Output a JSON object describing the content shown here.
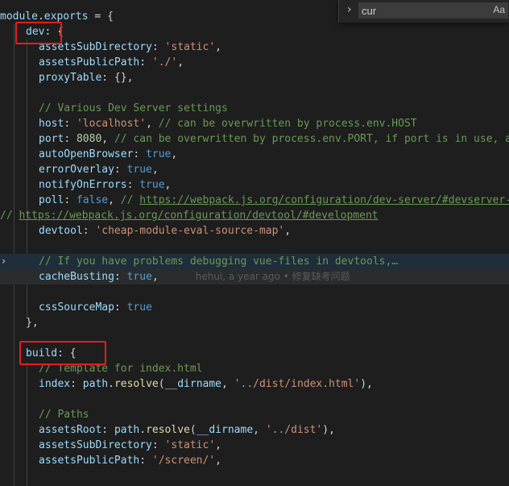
{
  "search": {
    "value": "cur",
    "match_case_label": "Aa"
  },
  "code": {
    "l0": {
      "a": "module",
      "b": ".",
      "c": "exports",
      "d": " = {"
    },
    "l1": {
      "a": "dev",
      "b": ": {"
    },
    "l2": {
      "a": "assetsSubDirectory",
      "b": ": ",
      "c": "'static'",
      "d": ","
    },
    "l3": {
      "a": "assetsPublicPath",
      "b": ": ",
      "c": "'./'",
      "d": ","
    },
    "l4": {
      "a": "proxyTable",
      "b": ": {},"
    },
    "l6": {
      "a": "// Various Dev Server settings"
    },
    "l7": {
      "a": "host",
      "b": ": ",
      "c": "'localhost'",
      "d": ", ",
      "e": "// can be overwritten by process.env.HOST"
    },
    "l8": {
      "a": "port",
      "b": ": ",
      "c": "8080",
      "d": ", ",
      "e": "// can be overwritten by process.env.PORT, if port is in use, a"
    },
    "l9": {
      "a": "autoOpenBrowser",
      "b": ": ",
      "c": "true",
      "d": ","
    },
    "l10": {
      "a": "errorOverlay",
      "b": ": ",
      "c": "true",
      "d": ","
    },
    "l11": {
      "a": "notifyOnErrors",
      "b": ": ",
      "c": "true",
      "d": ","
    },
    "l12": {
      "a": "poll",
      "b": ": ",
      "c": "false",
      "d": ", ",
      "e": "// ",
      "f": "https://webpack.js.org/configuration/dev-server/#devserver-w"
    },
    "l13": {
      "a": "// ",
      "b": "https://webpack.js.org/configuration/devtool/#development"
    },
    "l14": {
      "a": "devtool",
      "b": ": ",
      "c": "'cheap-module-eval-source-map'",
      "d": ","
    },
    "l16": {
      "a": "// If you have problems debugging vue-files in devtools,…"
    },
    "l17": {
      "a": "cacheBusting",
      "b": ": ",
      "c": "true",
      "d": ",",
      "blame": "hehui, a year ago • 修复缺考问题"
    },
    "l19": {
      "a": "cssSourceMap",
      "b": ": ",
      "c": "true"
    },
    "l20": {
      "a": "},"
    },
    "l22": {
      "a": "build",
      "b": ": {"
    },
    "l23": {
      "a": "// Template for index.html"
    },
    "l24": {
      "a": "index",
      "b": ": ",
      "c": "path",
      "d": ".",
      "e": "resolve",
      "f": "(",
      "g": "__dirname",
      "h": ", ",
      "i": "'../dist/index.html'",
      "j": "),"
    },
    "l26": {
      "a": "// Paths"
    },
    "l27": {
      "a": "assetsRoot",
      "b": ": ",
      "c": "path",
      "d": ".",
      "e": "resolve",
      "f": "(",
      "g": "__dirname",
      "h": ", ",
      "i": "'../dist'",
      "j": "),"
    },
    "l28": {
      "a": "assetsSubDirectory",
      "b": ": ",
      "c": "'static'",
      "d": ","
    },
    "l29": {
      "a": "assetsPublicPath",
      "b": ": ",
      "c": "'/screen/'",
      "d": ","
    }
  }
}
